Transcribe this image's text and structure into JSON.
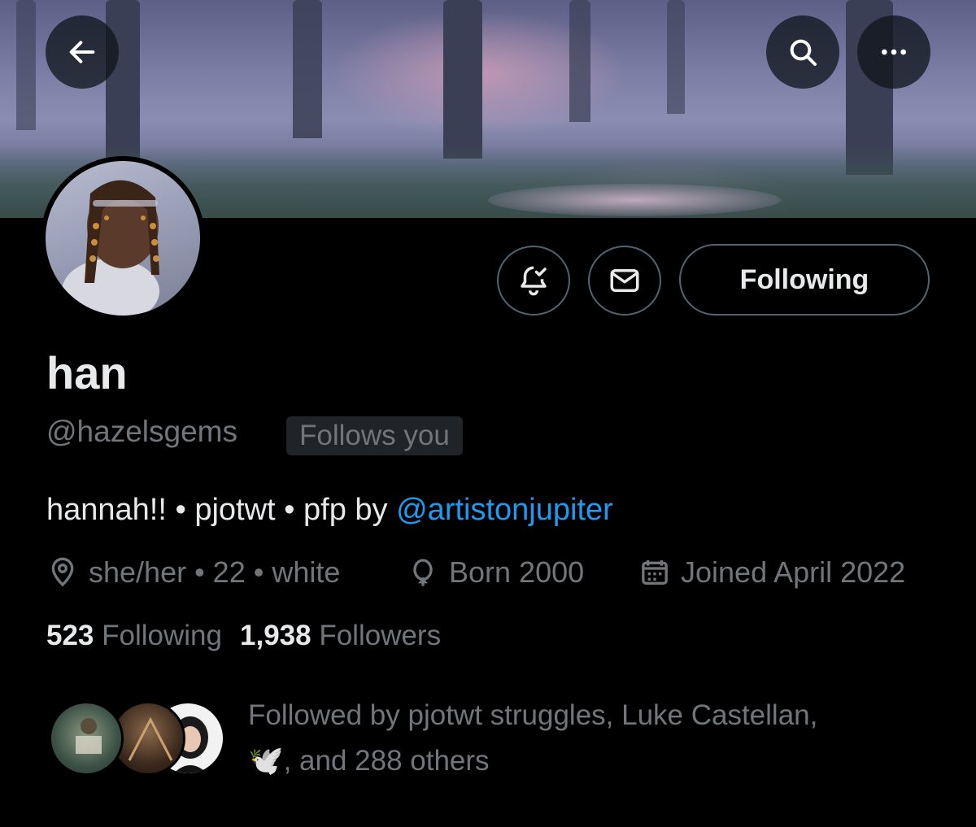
{
  "header": {
    "back_icon": "arrow-left-icon",
    "search_icon": "search-icon",
    "more_icon": "more-horizontal-icon"
  },
  "actions": {
    "notify_icon": "bell-check-icon",
    "message_icon": "envelope-icon",
    "following_label": "Following"
  },
  "profile": {
    "display_name": "han",
    "handle": "@hazelsgems",
    "follows_you": "Follows you",
    "bio_text": "hannah!! • pjotwt • pfp by ",
    "bio_link": "@artistonjupiter",
    "location": "she/her • 22 • white",
    "birthday": "Born 2000",
    "joined": "Joined April 2022"
  },
  "stats": {
    "following_count": "523",
    "following_label": "Following",
    "followers_count": "1,938",
    "followers_label": "Followers"
  },
  "followed_by": {
    "line1": "Followed by pjotwt struggles, Luke Castellan,",
    "emoji": "🕊️",
    "line2": ", and 288 others"
  },
  "colors": {
    "accent_link": "#1d9bf0",
    "secondary_text": "#71767b",
    "border": "#536471"
  }
}
